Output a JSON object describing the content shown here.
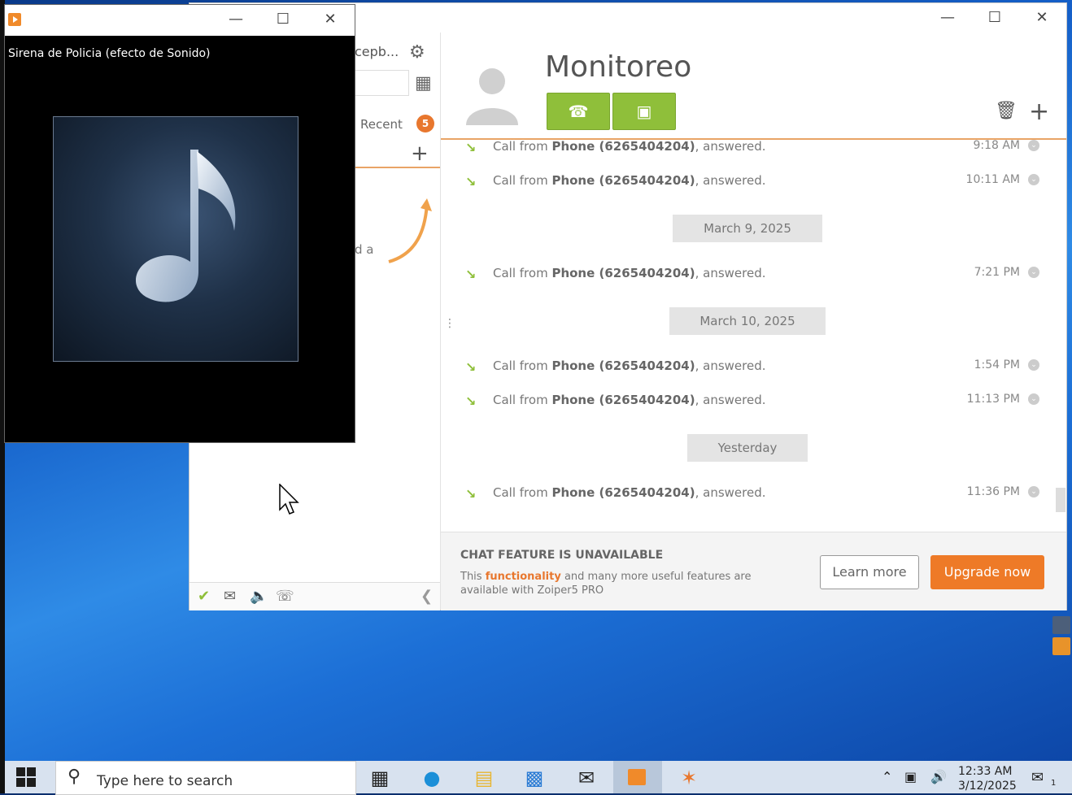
{
  "player": {
    "title": "Sirena de Policia (efecto de Sonido)",
    "art_icon": "music-note-icon"
  },
  "zoiper": {
    "sidebar": {
      "account_partial": "cepb...",
      "recent_tab": "Recent",
      "recent_badge": "5",
      "partial_hint": "d a"
    },
    "contact": {
      "name": "Monitoreo"
    },
    "history": [
      {
        "type": "call",
        "prefix": "Call from ",
        "caller": "Phone (6265404204)",
        "suffix": ", answered.",
        "time": "9:18 AM"
      },
      {
        "type": "call",
        "prefix": "Call from ",
        "caller": "Phone (6265404204)",
        "suffix": ", answered.",
        "time": "10:11 AM"
      },
      {
        "type": "date",
        "label": "March 9, 2025"
      },
      {
        "type": "call",
        "prefix": "Call from ",
        "caller": "Phone (6265404204)",
        "suffix": ", answered.",
        "time": "7:21 PM"
      },
      {
        "type": "date",
        "label": "March 10, 2025"
      },
      {
        "type": "call",
        "prefix": "Call from ",
        "caller": "Phone (6265404204)",
        "suffix": ", answered.",
        "time": "1:54 PM"
      },
      {
        "type": "call",
        "prefix": "Call from ",
        "caller": "Phone (6265404204)",
        "suffix": ", answered.",
        "time": "11:13 PM"
      },
      {
        "type": "date",
        "label": "Yesterday"
      },
      {
        "type": "call",
        "prefix": "Call from ",
        "caller": "Phone (6265404204)",
        "suffix": ", answered.",
        "time": "11:36 PM"
      }
    ],
    "chat_panel": {
      "title": "CHAT FEATURE IS UNAVAILABLE",
      "desc_before": "This ",
      "desc_highlight": "functionality",
      "desc_after": " and many more useful features are available with Zoiper5 PRO",
      "learn_more": "Learn more",
      "upgrade": "Upgrade now"
    },
    "colors": {
      "accent_orange": "#ee7a27",
      "call_green": "#8fbf3a"
    }
  },
  "taskbar": {
    "search_placeholder": "Type here to search",
    "time": "12:33 AM",
    "date": "3/12/2025",
    "notification_count": "1"
  }
}
